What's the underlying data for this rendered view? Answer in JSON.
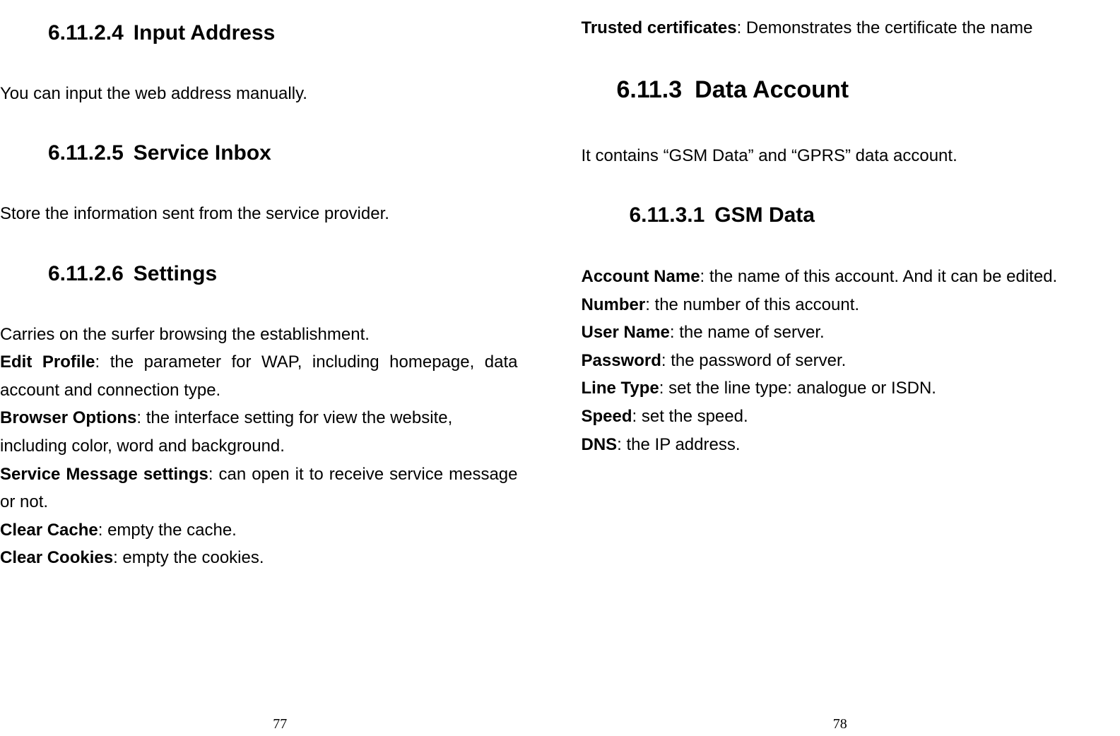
{
  "left": {
    "sec1": {
      "num": "6.11.2.4",
      "title": "Input Address"
    },
    "para1": "You can input the web address manually.",
    "sec2": {
      "num": "6.11.2.5",
      "title": "Service Inbox"
    },
    "para2": "Store the information sent from the service provider.",
    "sec3": {
      "num": "6.11.2.6",
      "title": "Settings"
    },
    "para3": "Carries on the surfer browsing the establishment.",
    "defs": {
      "d1_label": "Edit Profile",
      "d1_text": ": the parameter for WAP, including homepage, data account and connection type.",
      "d2_label": "Browser Options",
      "d2_text": ": the interface setting for view the website, including color, word and background.",
      "d3_label": "Service Message settings",
      "d3_text": ": can open it to receive service message or not.",
      "d4_label": "Clear Cache",
      "d4_text": ": empty the cache.",
      "d5_label": "Clear Cookies",
      "d5_text": ": empty the cookies."
    },
    "page_number": "77"
  },
  "right": {
    "top": {
      "label": "Trusted certificates",
      "text": ": Demonstrates the certificate the name"
    },
    "sec1": {
      "num": "6.11.3",
      "title": "Data Account"
    },
    "para1": "It contains “GSM Data” and “GPRS” data account.",
    "sec2": {
      "num": "6.11.3.1",
      "title": "GSM Data"
    },
    "defs": {
      "d1_label": "Account Name",
      "d1_text": ": the name of this account. And it can be edited.",
      "d2_label": "Number",
      "d2_text": ": the number of this account.",
      "d3_label": "User Name",
      "d3_text": ": the name of server.",
      "d4_label": "Password",
      "d4_text": ": the password of server.",
      "d5_label": "Line Type",
      "d5_text": ": set the line type: analogue or ISDN.",
      "d6_label": "Speed",
      "d6_text": ": set the speed.",
      "d7_label": "DNS",
      "d7_text": ": the IP address."
    },
    "page_number": "78"
  }
}
